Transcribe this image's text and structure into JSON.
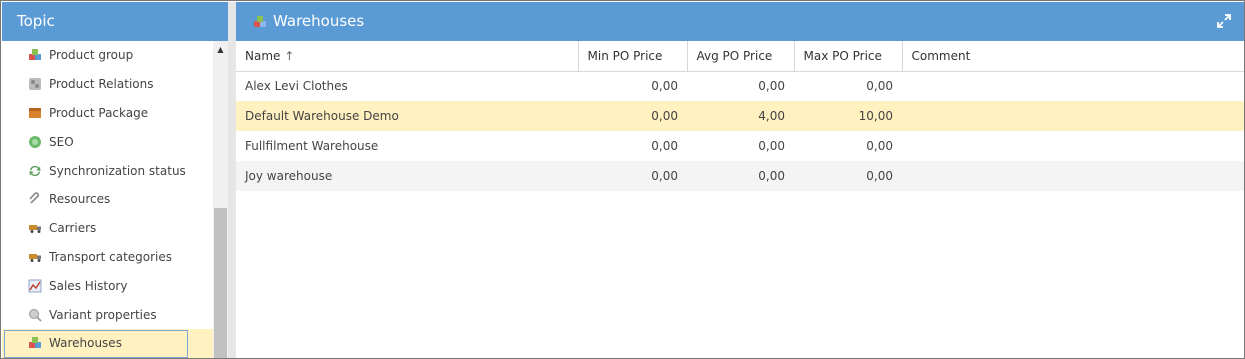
{
  "left_panel": {
    "title": "Topic",
    "items": [
      {
        "label": "Product group",
        "icon": "cubes-icon"
      },
      {
        "label": "Product Relations",
        "icon": "relations-icon"
      },
      {
        "label": "Product Package",
        "icon": "package-icon"
      },
      {
        "label": "SEO",
        "icon": "globe-icon"
      },
      {
        "label": "Synchronization status",
        "icon": "sync-icon"
      },
      {
        "label": "Resources",
        "icon": "paperclip-icon"
      },
      {
        "label": "Carriers",
        "icon": "truck-icon"
      },
      {
        "label": "Transport categories",
        "icon": "truck-icon"
      },
      {
        "label": "Sales History",
        "icon": "chart-icon"
      },
      {
        "label": "Variant properties",
        "icon": "variant-icon"
      },
      {
        "label": "Warehouses",
        "icon": "cubes-icon",
        "selected": true
      }
    ]
  },
  "main": {
    "title": "Warehouses",
    "columns": [
      "Name",
      "Min PO Price",
      "Avg PO Price",
      "Max PO Price",
      "Comment"
    ],
    "sort_indicator": "↑",
    "rows": [
      {
        "name": "Alex Levi Clothes",
        "min": "0,00",
        "avg": "0,00",
        "max": "0,00",
        "comment": ""
      },
      {
        "name": "Default Warehouse Demo",
        "min": "0,00",
        "avg": "4,00",
        "max": "10,00",
        "comment": ""
      },
      {
        "name": "Fullfilment Warehouse",
        "min": "0,00",
        "avg": "0,00",
        "max": "0,00",
        "comment": ""
      },
      {
        "name": "Joy warehouse",
        "min": "0,00",
        "avg": "0,00",
        "max": "0,00",
        "comment": ""
      }
    ]
  },
  "colors": {
    "header_blue": "#5b9bd5",
    "selection_yellow": "#fff1c0",
    "selection_border": "#7aa7d8"
  }
}
